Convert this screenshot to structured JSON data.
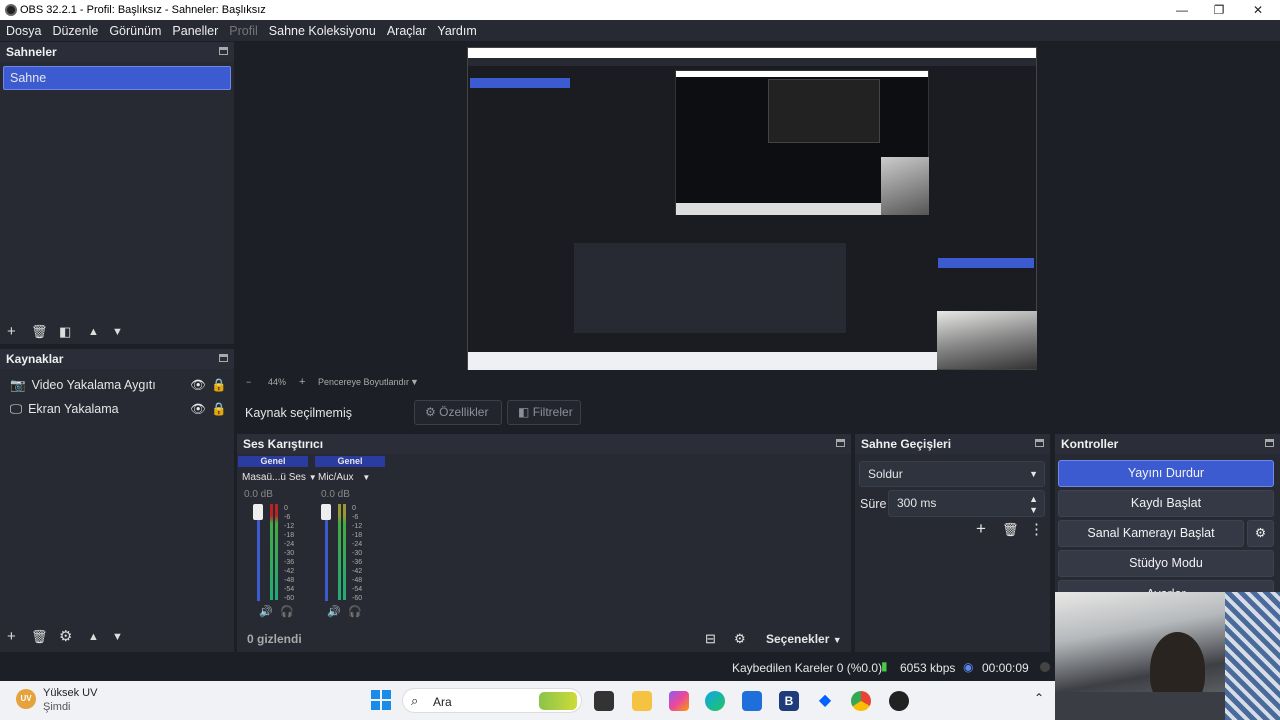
{
  "window": {
    "title": "OBS 32.2.1 - Profil: Başlıksız - Sahneler: Başlıksız",
    "min": "—",
    "max": "❐",
    "close": "✕"
  },
  "menu": [
    "Dosya",
    "Düzenle",
    "Görünüm",
    "Paneller",
    "Profil",
    "Sahne Koleksiyonu",
    "Araçlar",
    "Yardım"
  ],
  "scenes": {
    "title": "Sahneler",
    "items": [
      "Sahne"
    ]
  },
  "sources": {
    "title": "Kaynaklar",
    "items": [
      "Video Yakalama Aygıtı",
      "Ekran Yakalama"
    ]
  },
  "preview": {
    "zoom": "44%",
    "fit_label": "Pencereye Boyutlandır"
  },
  "source_toolbar": {
    "status": "Kaynak seçilmemiş",
    "properties": "Özellikler",
    "filters": "Filtreler"
  },
  "mixer": {
    "title": "Ses Karıştırıcı",
    "channels": [
      {
        "header": "Genel",
        "name": "Masaü...ü Ses",
        "db": "0.0 dB"
      },
      {
        "header": "Genel",
        "name": "Mic/Aux",
        "db": "0.0 dB"
      }
    ],
    "scale": [
      "0",
      "-6",
      "-12",
      "-18",
      "-24",
      "-30",
      "-36",
      "-42",
      "-48",
      "-54",
      "-60"
    ],
    "hidden": "0 gizlendi",
    "options": "Seçenekler"
  },
  "transitions": {
    "title": "Sahne Geçişleri",
    "selected": "Soldur",
    "duration_label": "Süre",
    "duration": "300 ms"
  },
  "controls": {
    "title": "Kontroller",
    "stop_stream": "Yayını Durdur",
    "start_record": "Kaydı Başlat",
    "virtual_cam": "Sanal Kamerayı Başlat",
    "studio": "Stüdyo Modu",
    "settings": "Ayarlar"
  },
  "status": {
    "dropped": "Kaybedilen Kareler 0 (%0.0)",
    "bitrate": "6053 kbps",
    "time": "00:00:09"
  },
  "taskbar": {
    "notif_title": "Yüksek UV",
    "notif_sub": "Şimdi",
    "search": "Ara"
  },
  "colors": {
    "accent": "#3c5bd0",
    "panel": "#272a33",
    "bg": "#1d1f26"
  }
}
